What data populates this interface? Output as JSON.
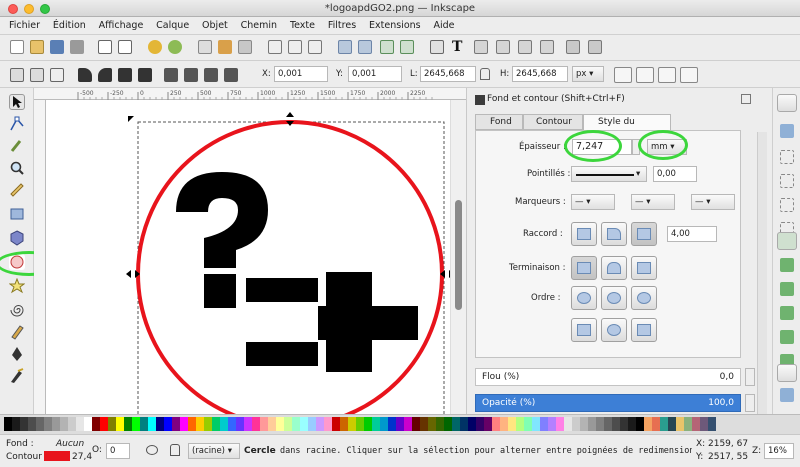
{
  "window": {
    "title": "*logoapdGO2.png — Inkscape"
  },
  "menu": [
    "Fichier",
    "Édition",
    "Affichage",
    "Calque",
    "Objet",
    "Chemin",
    "Texte",
    "Filtres",
    "Extensions",
    "Aide"
  ],
  "controls": {
    "x_label": "X:",
    "x_value": "0,001",
    "y_label": "Y:",
    "y_value": "0,001",
    "w_label": "L:",
    "w_value": "2645,668",
    "h_label": "H:",
    "h_value": "2645,668",
    "unit": "px"
  },
  "ruler": {
    "ticks": [
      "-500",
      "-250",
      "0",
      "250",
      "500",
      "750",
      "1000",
      "1250",
      "1500",
      "1750",
      "2000",
      "2250"
    ]
  },
  "panel": {
    "title": "Fond et contour (Shift+Ctrl+F)",
    "tabs": [
      "Fond",
      "Contour",
      "Style du contour"
    ],
    "active_tab": "Style du contour",
    "stroke_width_label": "Épaisseur :",
    "stroke_width_value": "7,247",
    "stroke_unit": "mm",
    "dashes_label": "Pointillés :",
    "dash_offset": "0,00",
    "markers_label": "Marqueurs :",
    "join_label": "Raccord :",
    "miter_value": "4,00",
    "cap_label": "Terminaison :",
    "order_label": "Ordre :",
    "blur_label": "Flou (%)",
    "blur_value": "0,0",
    "opacity_label": "Opacité (%)",
    "opacity_value": "100,0"
  },
  "status": {
    "fill_label": "Fond :",
    "fill_value": "Aucun",
    "stroke_label": "Contour :",
    "stroke_color": "#e8141c",
    "stroke_width": "27,4",
    "opacity_label": "O:",
    "opacity_value": "0",
    "layer": "(racine)",
    "object_name": "Cercle",
    "message": "dans racine. Cliquer sur la sélection pour alterner entre poignées de redimensionnement et de r…",
    "x_label": "X:",
    "x_coord": "2159, 67",
    "y_label": "Y:",
    "y_coord": "2517, 55",
    "zoom_label": "Z:",
    "zoom": "16%"
  },
  "colors": {
    "accent": "#3d7fd6",
    "stroke": "#e8141c",
    "highlight": "#3cd63c"
  }
}
